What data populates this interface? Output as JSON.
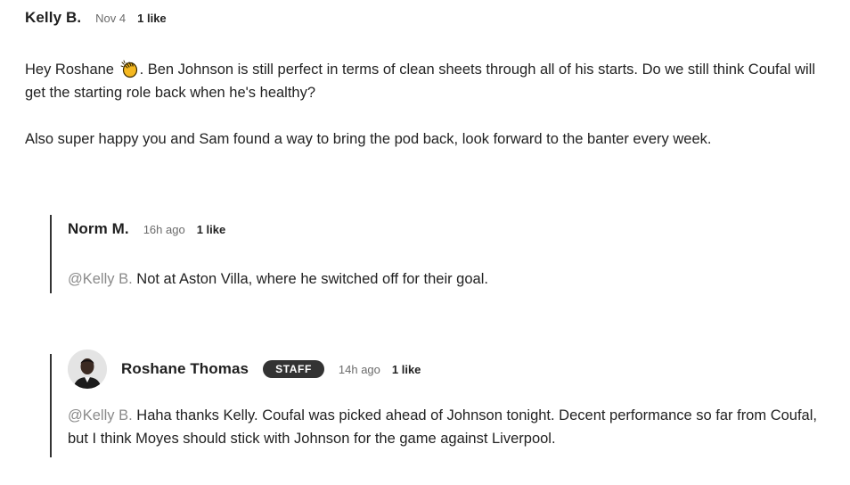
{
  "comments": [
    {
      "author": "Kelly B.",
      "time": "Nov 4",
      "likes": "1 like",
      "paragraph1_before_emoji": "Hey Roshane ",
      "emoji": "clapping-hands-emoji",
      "paragraph1_after_emoji": ". Ben Johnson is still perfect in terms of clean sheets through all of his starts. Do we still think Coufal will get the starting role back when he's healthy?",
      "paragraph2": "Also super happy you and Sam found a way to bring the pod back, look forward to the banter every week."
    }
  ],
  "replies": [
    {
      "author": "Norm M.",
      "time": "16h ago",
      "likes": "1 like",
      "mention": "@Kelly B.",
      "text": " Not at Aston Villa, where he switched off for their goal."
    },
    {
      "author": "Roshane Thomas",
      "badge": "STAFF",
      "time": "14h ago",
      "likes": "1 like",
      "mention": "@Kelly B.",
      "text": " Haha thanks Kelly. Coufal was picked ahead of Johnson tonight. Decent performance so far from Coufal, but I think Moyes should stick with Johnson for the game against Liverpool.",
      "avatar": "author-avatar"
    }
  ],
  "colors": {
    "text": "#222222",
    "muted": "#6b6b6b",
    "mention": "#8a8a8a",
    "thread_line": "#333333",
    "badge_bg": "#333333",
    "badge_text": "#ffffff",
    "background": "#ffffff"
  }
}
